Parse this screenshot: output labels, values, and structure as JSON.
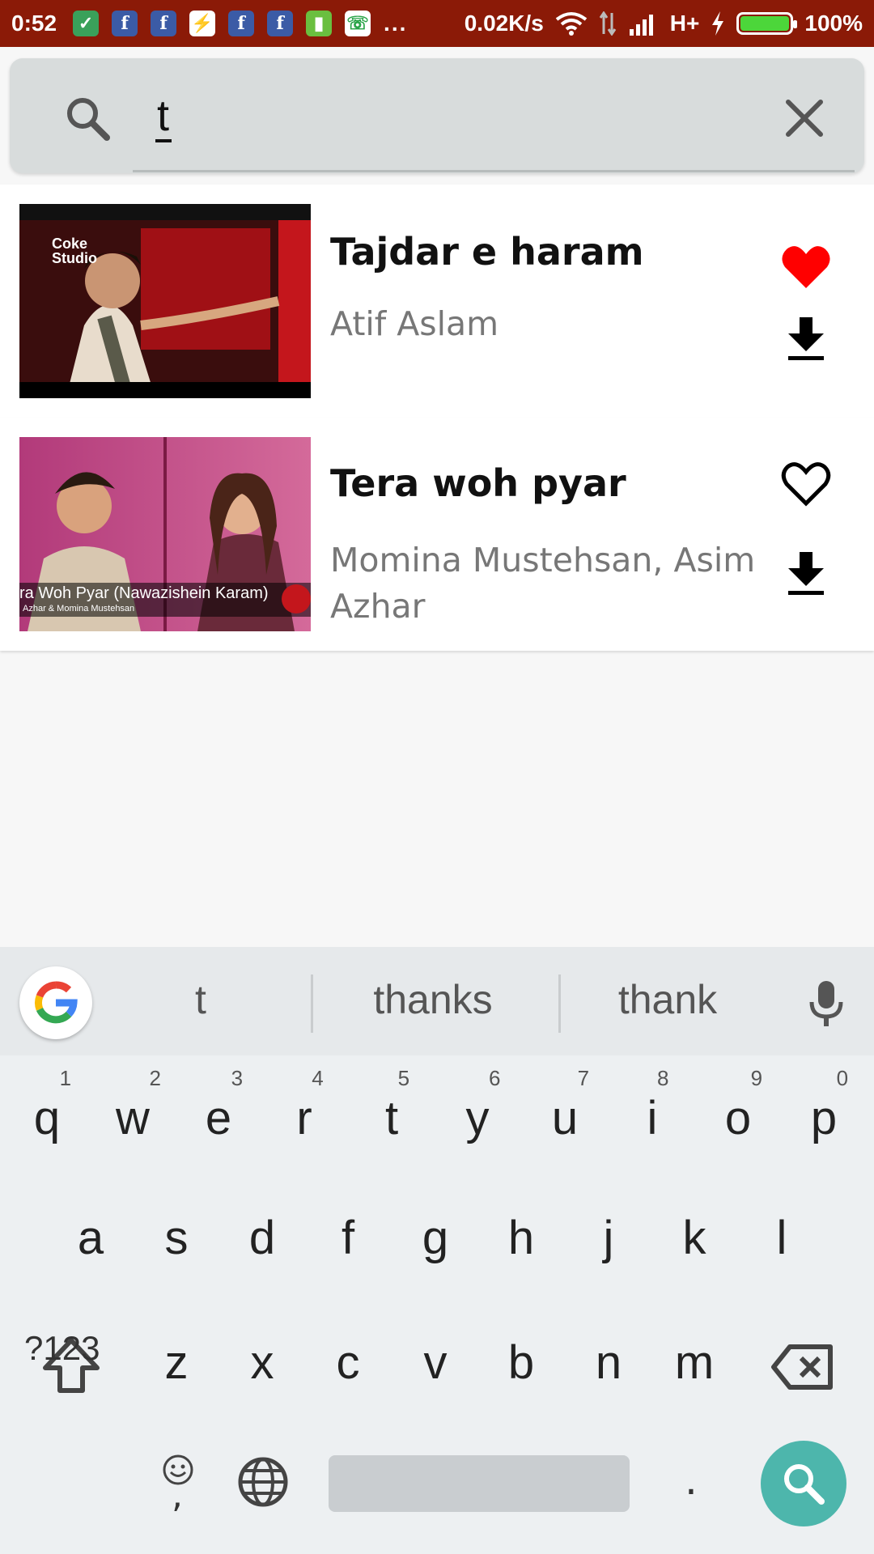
{
  "status_bar": {
    "time": "0:52",
    "notification_icons": [
      "shield-icon",
      "facebook-icon",
      "facebook-icon",
      "messenger-icon",
      "facebook-icon",
      "facebook-icon",
      "battery-app-icon",
      "whatsapp-icon"
    ],
    "overflow": "...",
    "speed": "0.02K/s",
    "network": "H+",
    "battery": "100%",
    "battery_level": 1.0
  },
  "search": {
    "query": "t"
  },
  "results": [
    {
      "title": "Tajdar e haram",
      "artist": "Atif Aslam",
      "favorited": true,
      "thumb_caption": "Coke Studio"
    },
    {
      "title": "Tera woh pyar",
      "artist": "Momina Mustehsan, Asim Azhar",
      "favorited": false,
      "thumb_caption": "ra Woh Pyar (Nawazishein Karam)",
      "thumb_subcaption": "Azhar & Momina Mustehsan"
    }
  ],
  "keyboard": {
    "suggestions": [
      "t",
      "thanks",
      "thank"
    ],
    "row1": [
      "q",
      "w",
      "e",
      "r",
      "t",
      "y",
      "u",
      "i",
      "o",
      "p"
    ],
    "row1_hints": [
      "1",
      "2",
      "3",
      "4",
      "5",
      "6",
      "7",
      "8",
      "9",
      "0"
    ],
    "row2": [
      "a",
      "s",
      "d",
      "f",
      "g",
      "h",
      "j",
      "k",
      "l"
    ],
    "row3": [
      "z",
      "x",
      "c",
      "v",
      "b",
      "n",
      "m"
    ],
    "symbols_label": "?123",
    "emoji_comma": ",",
    "period": "."
  },
  "colors": {
    "status_bar": "#8b1a07",
    "accent": "#4db6ac",
    "heart": "#ff0000"
  }
}
